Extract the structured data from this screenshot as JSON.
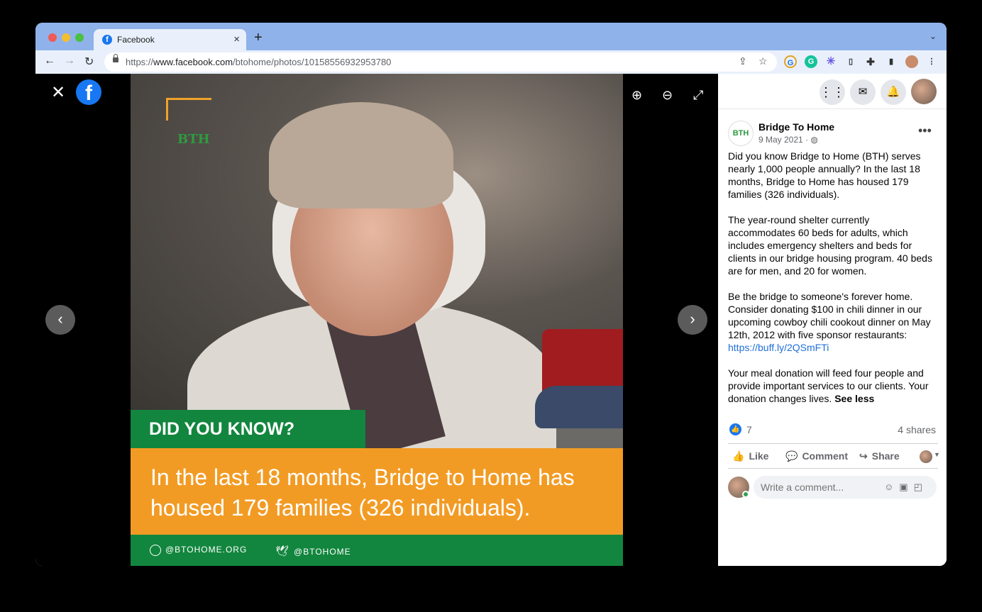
{
  "browser": {
    "tab_title": "Facebook",
    "tab_favicon": "f",
    "url_prefix": "https://",
    "url_host": "www.facebook.com",
    "url_path": "/btohome/photos/10158556932953780"
  },
  "photo": {
    "logo_text": "BTH",
    "headline": "DID YOU KNOW?",
    "body": "In the last 18 months, Bridge to Home has housed 179 families (326 individuals).",
    "website": "@BTOHOME.ORG",
    "twitter": "@BTOHOME"
  },
  "post": {
    "page_name": "Bridge To Home",
    "date": "9 May 2021 · ",
    "paragraph1": "Did you know Bridge to Home (BTH) serves nearly 1,000 people annually? In the last 18 months, Bridge to Home has housed 179 families (326 individuals).",
    "paragraph2": "The year-round shelter currently accommodates 60 beds for adults, which includes emergency shelters and beds for clients in our bridge housing program. 40 beds are for men, and 20 for women.",
    "paragraph3": "Be the bridge to someone's forever home. Consider donating $100 in chili dinner in our upcoming cowboy chili cookout dinner on May 12th, 2012 with five sponsor restaurants:",
    "link": "https://buff.ly/2QSmFTi",
    "paragraph4": "Your meal donation will feed four people and provide important services to our clients. Your donation changes lives.",
    "see_less": "See less",
    "like_count": "7",
    "shares": "4 shares"
  },
  "actions": {
    "like": "Like",
    "comment": "Comment",
    "share": "Share"
  },
  "comment_box": {
    "placeholder": "Write a comment..."
  },
  "colors": {
    "facebook_blue": "#1877f2",
    "bth_green": "#12863e",
    "bth_orange": "#f29b24"
  }
}
